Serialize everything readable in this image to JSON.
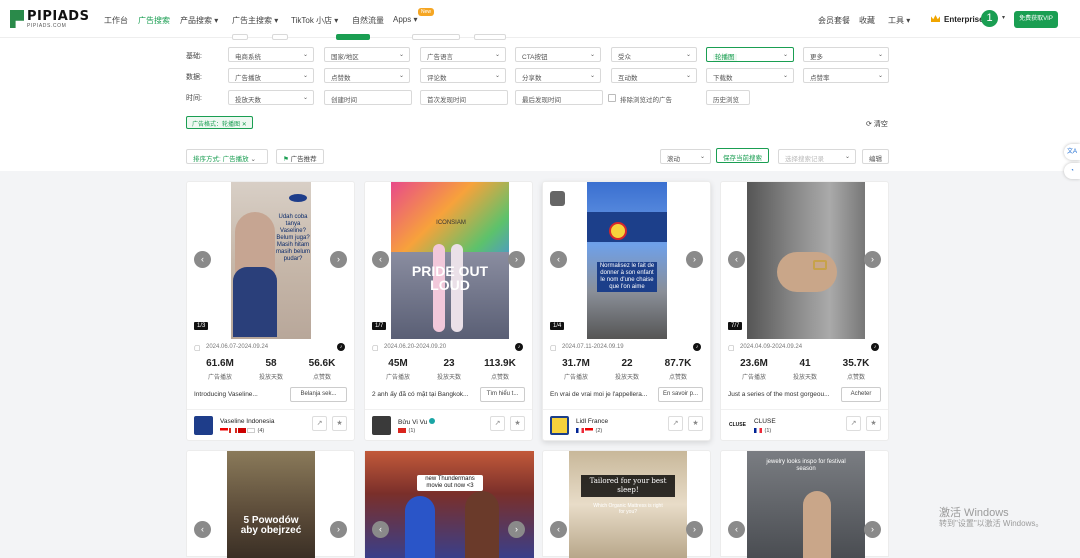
{
  "nav": {
    "logo": "PIPIADS",
    "logo_sub": "PIPIADS.COM",
    "items": [
      {
        "label": "工作台"
      },
      {
        "label": "广告搜索"
      },
      {
        "label": "产品搜索 ▾"
      },
      {
        "label": "广告主搜索 ▾"
      },
      {
        "label": "TikTok 小店 ▾"
      },
      {
        "label": "自然流量"
      },
      {
        "label": "Apps ▾"
      }
    ],
    "new_badge": "New",
    "right": {
      "membership": "会员套餐",
      "favorites": "收藏",
      "tools": "工具 ▾",
      "plan": "Enterprise",
      "avatar": "1",
      "vip_button": "免费获取VIP"
    }
  },
  "filters": {
    "rows": [
      {
        "label": "基础:",
        "selects": [
          "电商系统",
          "国家/地区",
          "广告语言",
          "CTA按钮",
          "受众",
          "轮播图",
          "更多"
        ]
      },
      {
        "label": "数据:",
        "selects": [
          "广告播放",
          "点赞数",
          "评论数",
          "分享数",
          "互动数",
          "下载数",
          "点赞率"
        ]
      },
      {
        "label": "时间:",
        "selects": [
          "投放天数",
          "创建时间",
          "首次发现时间",
          "最后发现时间",
          "排除浏览过的广告",
          "历史浏览"
        ]
      }
    ],
    "active_tag": "广告格式：轮播图",
    "clear": "清空",
    "sort": "排序方式: 广告播放",
    "recommend": "广告推荐",
    "scroll": "滚动",
    "save_search": "保存当前搜索",
    "saved_placeholder": "选择搜索记录",
    "edit": "编辑"
  },
  "cards": [
    {
      "count": "1/3",
      "date": "2024.06.07-2024.09.24",
      "stats": [
        {
          "v": "61.6M",
          "l": "广告播放"
        },
        {
          "v": "58",
          "l": "投放天数"
        },
        {
          "v": "56.6K",
          "l": "点赞数"
        }
      ],
      "desc": "Introducing Vaseline...",
      "cta": "Belanja sek...",
      "brand": "Vaseline Indonesia",
      "flags_count": "(4)",
      "ad_text": "Udah coba tanya Vaseline? Belum juga? Masih hitam masih belum pudar?",
      "ad_brand": "Vaseline"
    },
    {
      "count": "1/7",
      "date": "2024.06.20-2024.09.20",
      "stats": [
        {
          "v": "45M",
          "l": "广告播放"
        },
        {
          "v": "23",
          "l": "投放天数"
        },
        {
          "v": "113.9K",
          "l": "点赞数"
        }
      ],
      "desc": "2 anh ấy đã có mặt tại Bangkok...",
      "cta": "Tìm hiểu t...",
      "brand": "Bửu Vi Vu",
      "flags_count": "(1)",
      "ad_text": "PRIDE OUT LOUD",
      "ad_brand": "ICONSIAM"
    },
    {
      "count": "1/4",
      "date": "2024.07.11-2024.09.19",
      "stats": [
        {
          "v": "31.7M",
          "l": "广告播放"
        },
        {
          "v": "22",
          "l": "投放天数"
        },
        {
          "v": "87.7K",
          "l": "点赞数"
        }
      ],
      "desc": "En vrai de vrai moi je l'appellera...",
      "cta": "En savoir p...",
      "brand": "Lidl France",
      "flags_count": "(2)",
      "ad_text": "Normalisez le fait de donner à son enfant le nom d'une chaise que l'on aime",
      "ad_brand": "Lidl"
    },
    {
      "count": "7/7",
      "date": "2024.04.09-2024.09.24",
      "stats": [
        {
          "v": "23.6M",
          "l": "广告播放"
        },
        {
          "v": "41",
          "l": "投放天数"
        },
        {
          "v": "35.7K",
          "l": "点赞数"
        }
      ],
      "desc": "Just a series of the most gorgeou...",
      "cta": "Acheter",
      "brand": "CLUSE",
      "flags_count": "(1)",
      "ad_text": "",
      "ad_brand": "CLUSE"
    }
  ],
  "bottom_cards": [
    {
      "ad_text": "5 Powodów aby obejrzeć"
    },
    {
      "ad_text": "new Thundermans movie out now <3"
    },
    {
      "ad_text": "Tailored for your best sleep!",
      "ad_sub": "Which Organic Mattress is right for you?"
    },
    {
      "ad_text": "jewelry looks inspo for festival season"
    }
  ],
  "watermark": {
    "line1": "激活 Windows",
    "line2": "转到\"设置\"以激活 Windows。"
  },
  "side": {
    "translate": "文A"
  },
  "colors": {
    "accent": "#1a9e52",
    "badge": "#f5a623"
  }
}
